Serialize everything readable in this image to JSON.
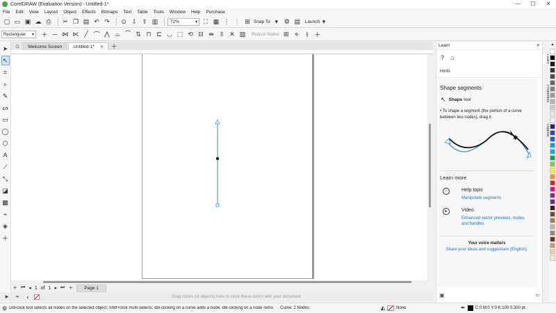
{
  "window": {
    "title": "CorelDRAW (Evaluation Version) - Untitled-1*",
    "controls": [
      "—",
      "☐",
      "✕"
    ]
  },
  "menu": [
    "File",
    "Edit",
    "View",
    "Layout",
    "Object",
    "Effects",
    "Bitmaps",
    "Text",
    "Table",
    "Tools",
    "Window",
    "Help",
    "Purchase"
  ],
  "standard_toolbar": {
    "zoom_value": "72%",
    "snap_to_label": "Snap To",
    "launch_label": "Launch"
  },
  "property_bar": {
    "selection_mode": "Rectangular",
    "reduce_nodes_label": "Reduce Nodes"
  },
  "document_tabs": [
    {
      "label": "Welcome Screen",
      "active": false
    },
    {
      "label": "Untitled-1*",
      "active": true
    }
  ],
  "page_navigator": {
    "current": "1",
    "of_label": "of",
    "total": "1",
    "page_tab": "Page 1"
  },
  "color_dock_hint": "Drag colors (or objects) here to store these colors with your document",
  "docker": {
    "header": "Learn",
    "hints_label": "Hints",
    "section_title": "Shape segments",
    "tool_name": "Shape",
    "tool_suffix": "tool",
    "description": "• To shape a segment (the portion of a curve between two nodes), drag it.",
    "learn_more_title": "Learn more",
    "help_topic": {
      "heading": "Help topic",
      "link": "Manipulate segments"
    },
    "video": {
      "heading": "Video",
      "link": "Enhanced vector previews, nodes, and handles"
    },
    "voice_title": "Your voice matters",
    "voice_link": "Share your ideas and suggestions (English)."
  },
  "side_tabs": [
    "Learn",
    "Properties",
    "Objects"
  ],
  "palette_colors": [
    "#ffffff",
    "#000000",
    "#1a1a1a",
    "#333333",
    "#4d4d4d",
    "#666666",
    "#808080",
    "#999999",
    "#b3b3b3",
    "#cccccc",
    "#e6e6e6",
    "#f2f2f2",
    "#1e2a78",
    "#2d4ea2",
    "#0072bc",
    "#00a0e3",
    "#00aeef",
    "#00a650",
    "#8dc63f",
    "#fff200",
    "#f7941d",
    "#ed1c24",
    "#ec008c",
    "#92278f",
    "#662d91",
    "#3b2314",
    "#754c24",
    "#a67c52",
    "#c7b299",
    "#998675",
    "#603913",
    "#c69c6d",
    "#e2d0b0",
    "#f5ead2"
  ],
  "status": {
    "message": "Dbl-click tool selects all nodes on the selected object; Shift+click multi-selects; dbl-clicking on a curve adds a node; dbl-clicking on a node removes it",
    "curve_info": "Curve: 2 Nodes",
    "fill_label": "None",
    "outline_label": "C:0 M:0 Y:0 K:100  0.300 pt"
  }
}
